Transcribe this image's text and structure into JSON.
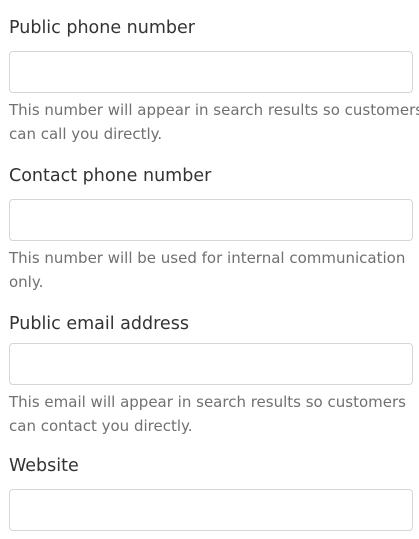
{
  "form": {
    "fields": [
      {
        "label": "Public phone number",
        "value": "",
        "help_lines": [
          "This number will appear in search results so customers",
          "can call you directly."
        ]
      },
      {
        "label": "Contact phone number",
        "value": "",
        "help_lines": [
          "This number will be used for internal communication",
          "only."
        ]
      },
      {
        "label": "Public email address",
        "value": "",
        "help_lines": [
          "This email will appear in search results so customers",
          "can contact you directly."
        ]
      },
      {
        "label": "Website",
        "value": "",
        "help_lines": []
      }
    ]
  }
}
